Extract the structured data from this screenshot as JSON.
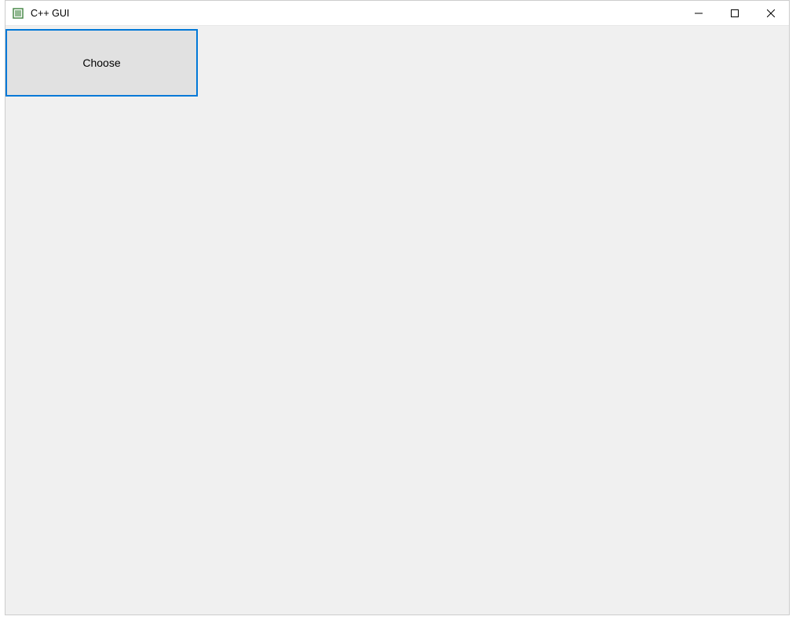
{
  "window": {
    "title": "C++ GUI"
  },
  "main": {
    "choose_button_label": "Choose"
  }
}
